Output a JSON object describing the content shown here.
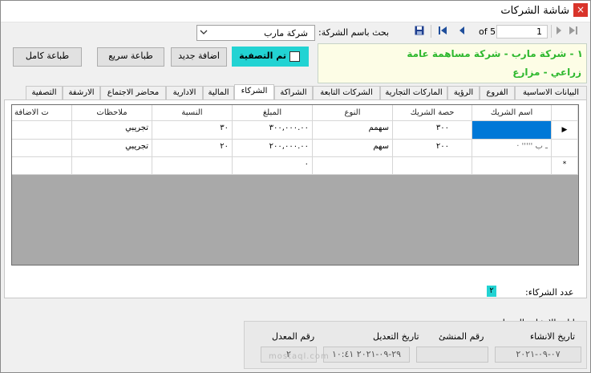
{
  "window": {
    "title": "شاشة الشركات",
    "close": "×"
  },
  "search": {
    "label": "بحث باسم الشركة:",
    "value": "شركة مارب"
  },
  "navigator": {
    "position": "1",
    "of_text": "of 5"
  },
  "buttons": {
    "add_new": "اضافة جديد",
    "print_quick": "طباعة سريع",
    "print_full": "طباعة كامل"
  },
  "liquidation": {
    "label": "تم التصفية",
    "checked": false
  },
  "company_info": {
    "line1": "١ - شركة مارب - شركة مساهمة عامة",
    "line2": "زراعي - مزارع"
  },
  "tabs": [
    {
      "label": "البيانات الاساسية",
      "active": false
    },
    {
      "label": "الفروع",
      "active": false
    },
    {
      "label": "الرؤية",
      "active": false
    },
    {
      "label": "الماركات التجارية",
      "active": false
    },
    {
      "label": "الشركات التابعة",
      "active": false
    },
    {
      "label": "الشراكة",
      "active": false
    },
    {
      "label": "الشركاء",
      "active": true
    },
    {
      "label": "المالية",
      "active": false
    },
    {
      "label": "الادارية",
      "active": false
    },
    {
      "label": "محاضر الاجتماع",
      "active": false
    },
    {
      "label": "الارشفة",
      "active": false
    },
    {
      "label": "التصفية",
      "active": false
    }
  ],
  "grid": {
    "columns": [
      "اسم الشريك",
      "حصة الشريك",
      "النوع",
      "المبلغ",
      "النسبة",
      "ملاحظات",
      "ت الاضافة"
    ],
    "rows": [
      {
        "indicator": "▶",
        "cells": [
          "",
          "٣٠٠",
          "سهمم",
          "٣٠٠,٠٠٠.٠٠",
          "٣٠",
          "تجريبي",
          ""
        ]
      },
      {
        "indicator": "",
        "cells": [
          "·  ''''' ـ ب",
          "٢٠٠",
          "سهم",
          "٢٠٠,٠٠٠.٠٠",
          "٢٠",
          "تجريبي",
          ""
        ]
      },
      {
        "indicator": "*",
        "cells": [
          "",
          "",
          "",
          "٠",
          "",
          "",
          ""
        ]
      }
    ]
  },
  "partners_count": {
    "label": "عدد الشركاء:",
    "value": "٢"
  },
  "meta": {
    "title": "بيانات الانشاء والتعديل:",
    "created_date_label": "تاريخ الانشاء",
    "creator_label": "رقم المنشئ",
    "modified_date_label": "تاريخ التعديل",
    "modifier_label": "رقم المعدل",
    "created_date": "٠٧-٠٩-٢٠٢١",
    "modified_date": "٢٩-٠٩-٢٠٢١ ١٠:٤١",
    "modifier_value": "٢"
  },
  "watermark": "mostaql.com",
  "colors": {
    "accent_cyan": "#22d3d3",
    "info_green": "#2eb82e",
    "selection_blue": "#0078d7",
    "close_red": "#d9342b"
  }
}
